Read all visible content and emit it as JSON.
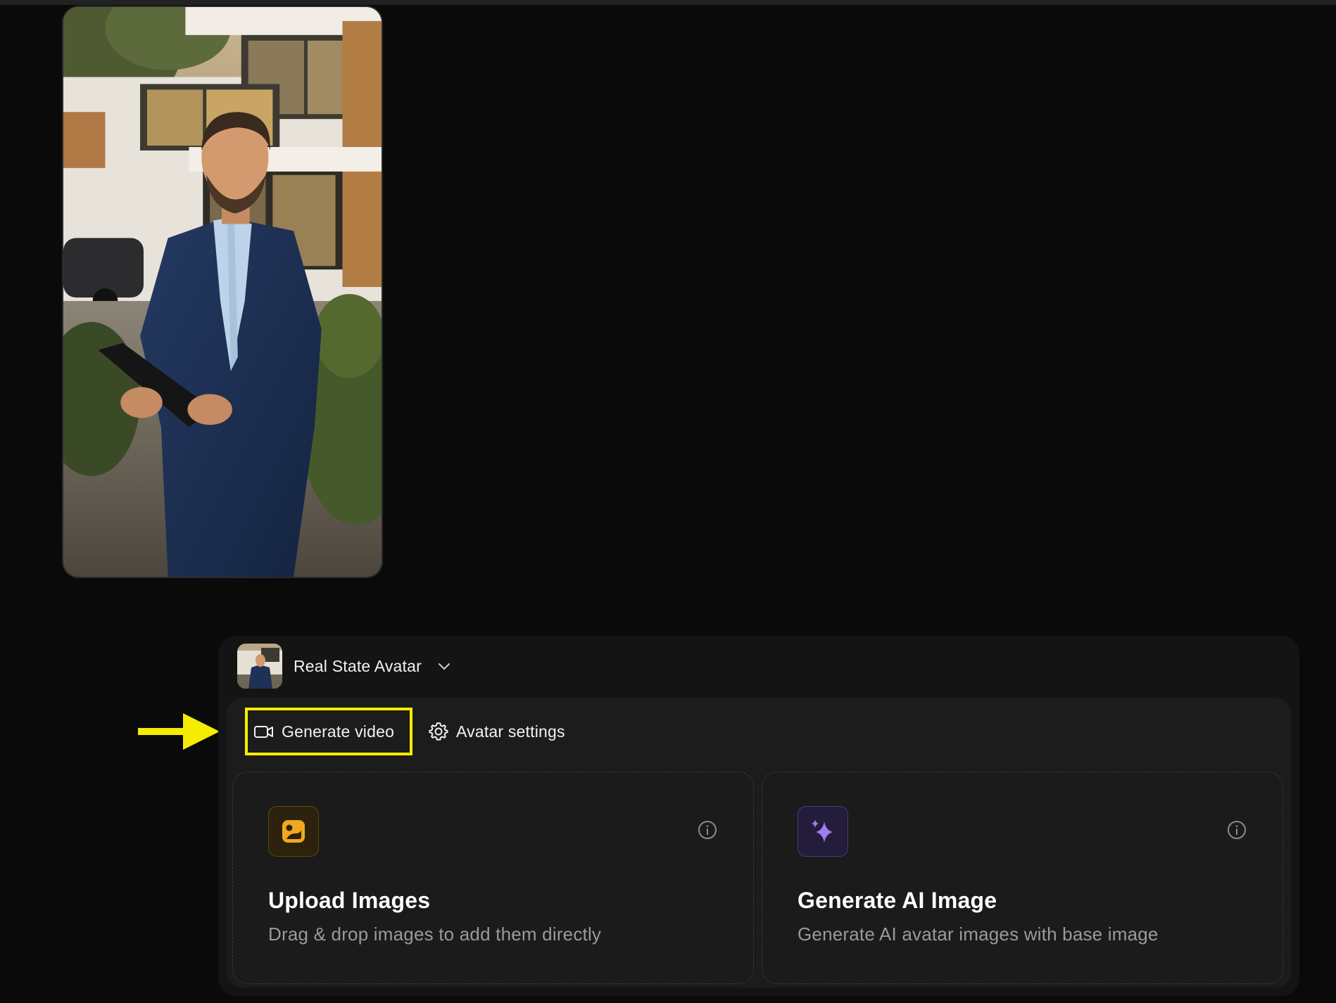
{
  "avatar": {
    "name": "Real State Avatar",
    "photo_icon": "avatar-photo",
    "dropdown_icon": "chevron-down-icon"
  },
  "tabs": [
    {
      "label": "Generate video",
      "icon": "video-camera-icon",
      "highlighted": true
    },
    {
      "label": "Avatar settings",
      "icon": "gear-icon",
      "highlighted": false
    }
  ],
  "cards": [
    {
      "title": "Upload Images",
      "description": "Drag & drop images to add them directly",
      "icon": "image-upload-icon",
      "accent": "#f0a91e"
    },
    {
      "title": "Generate AI Image",
      "description": "Generate AI avatar images with base image",
      "icon": "sparkle-icon",
      "accent": "#a07cf0"
    }
  ],
  "annotation": {
    "highlight_color": "#f5ec00",
    "arrow_icon": "arrow-right-icon"
  }
}
